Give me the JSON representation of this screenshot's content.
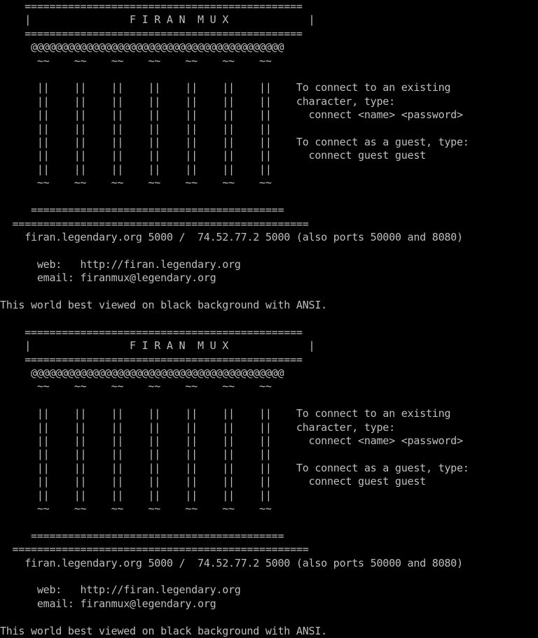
{
  "terminal": {
    "background_color": "#000000",
    "text_color": "#bfbfbf",
    "font_size_px": 15,
    "columns": 80,
    "title": "FIRAN MUX login screen"
  },
  "banner": {
    "rule_top": "    =============================================",
    "title_line": "    |                F I R A N  M U X             |",
    "rule_under_title": "    =============================================",
    "gate_row": "     @@@@@@@@@@@@@@@@@@@@@@@@@@@@@@@@@@@@@@@@@",
    "tilde_row": "      ~~    ~~    ~~    ~~    ~~    ~~    ~~",
    "pillar_row": "      ||    ||    ||    ||    ||    ||    ||",
    "rule_lower_inner": "     =========================================",
    "rule_lower_outer": "  ================================================",
    "address_line": "    firan.legendary.org 5000 /  74.52.77.2 5000 (also ports 50000 and 8080)",
    "web_line": "      web:   http://firan.legendary.org",
    "email_line": "      email: firanmux@legendary.org",
    "ansi_note": "This world best viewed on black background with ANSI."
  },
  "instructions": {
    "connect_existing_line1": "To connect to an existing",
    "connect_existing_line2": "character, type:",
    "connect_existing_command": "  connect <name> <password>",
    "connect_guest_line1": "To connect as a guest, type:",
    "connect_guest_command": "  connect guest guest"
  },
  "composed": {
    "block": "    =============================================\n    |                F I R A N  M U X             |\n    =============================================\n     @@@@@@@@@@@@@@@@@@@@@@@@@@@@@@@@@@@@@@@@@\n      ~~    ~~    ~~    ~~    ~~    ~~    ~~\n\n      ||    ||    ||    ||    ||    ||    ||    To connect to an existing\n      ||    ||    ||    ||    ||    ||    ||    character, type:\n      ||    ||    ||    ||    ||    ||    ||      connect <name> <password>\n      ||    ||    ||    ||    ||    ||    ||\n      ||    ||    ||    ||    ||    ||    ||    To connect as a guest, type:\n      ||    ||    ||    ||    ||    ||    ||      connect guest guest\n      ||    ||    ||    ||    ||    ||    ||\n      ~~    ~~    ~~    ~~    ~~    ~~    ~~\n\n     =========================================\n  ================================================\n    firan.legendary.org 5000 /  74.52.77.2 5000 (also ports 50000 and 8080)\n\n      web:   http://firan.legendary.org\n      email: firanmux@legendary.org\n\nThis world best viewed on black background with ANSI.\n"
  }
}
